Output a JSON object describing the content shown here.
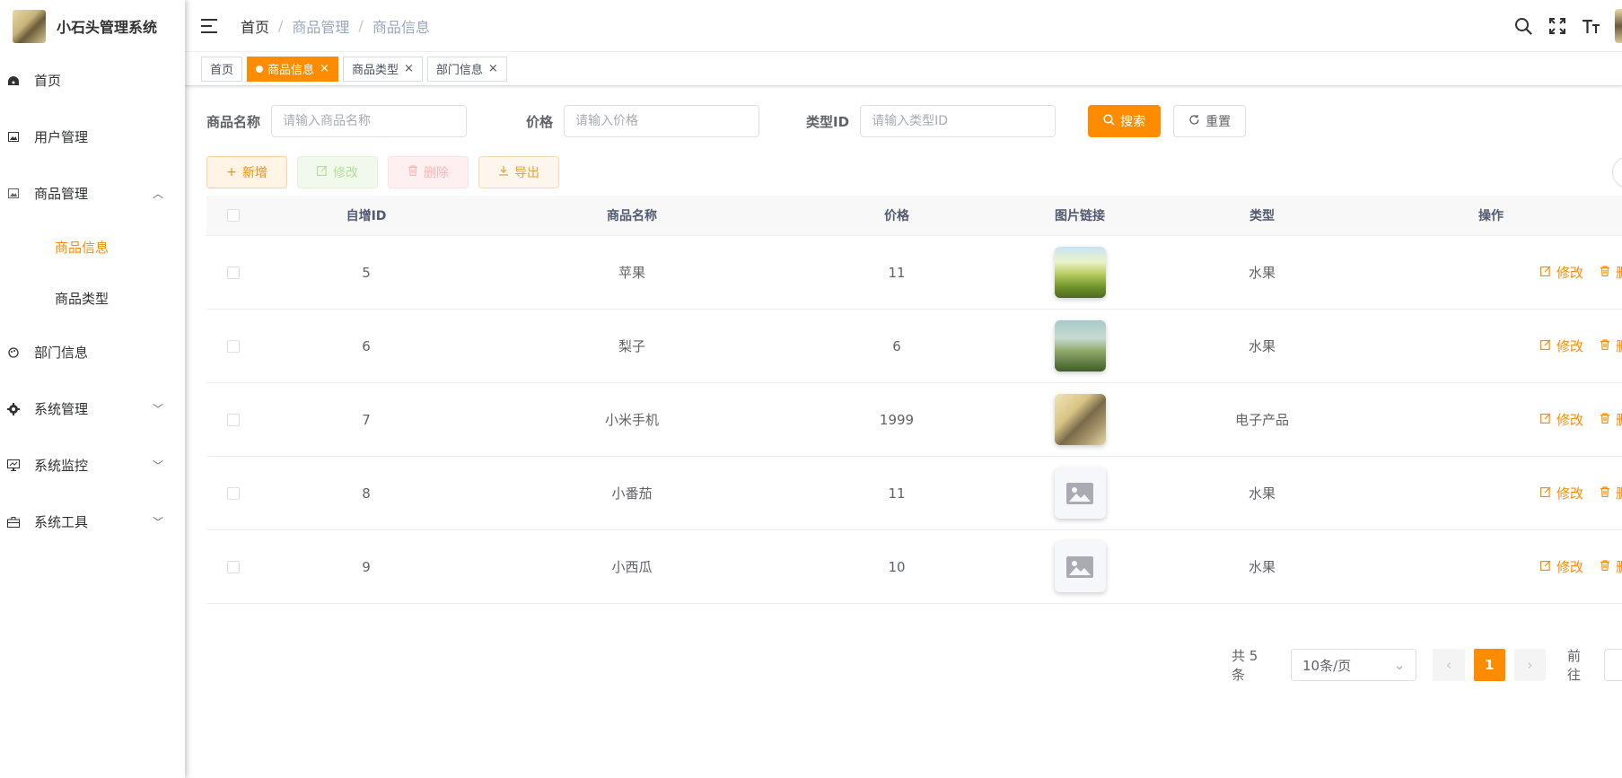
{
  "app": {
    "title": "小石头管理系统"
  },
  "sidebar": {
    "items": [
      {
        "label": "首页"
      },
      {
        "label": "用户管理"
      },
      {
        "label": "商品管理",
        "arrow": "︿"
      },
      {
        "label": "商品信息"
      },
      {
        "label": "商品类型"
      },
      {
        "label": "部门信息"
      },
      {
        "label": "系统管理",
        "arrow": "﹀"
      },
      {
        "label": "系统监控",
        "arrow": "﹀"
      },
      {
        "label": "系统工具",
        "arrow": "﹀"
      }
    ]
  },
  "breadcrumb": [
    "首页",
    "商品管理",
    "商品信息"
  ],
  "tags": [
    {
      "label": "首页"
    },
    {
      "label": "商品信息",
      "close": "×"
    },
    {
      "label": "商品类型",
      "close": "×"
    },
    {
      "label": "部门信息",
      "close": "×"
    }
  ],
  "search": {
    "name_label": "商品名称",
    "name_placeholder": "请输入商品名称",
    "price_label": "价格",
    "price_placeholder": "请输入价格",
    "type_label": "类型ID",
    "type_placeholder": "请输入类型ID",
    "search_btn": "搜索",
    "reset_btn": "重置"
  },
  "toolbar": {
    "add": "新增",
    "edit": "修改",
    "delete": "删除",
    "export": "导出"
  },
  "table": {
    "headers": [
      "自增ID",
      "商品名称",
      "价格",
      "图片链接",
      "类型",
      "操作"
    ],
    "rows": [
      {
        "id": "5",
        "name": "苹果",
        "price": "11",
        "type": "水果"
      },
      {
        "id": "6",
        "name": "梨子",
        "price": "6",
        "type": "水果"
      },
      {
        "id": "7",
        "name": "小米手机",
        "price": "1999",
        "type": "电子产品"
      },
      {
        "id": "8",
        "name": "小番茄",
        "price": "11",
        "type": "水果"
      },
      {
        "id": "9",
        "name": "小西瓜",
        "price": "10",
        "type": "水果"
      }
    ],
    "op_edit": "修改",
    "op_delete": "删除"
  },
  "pagination": {
    "total": "共 5 条",
    "size": "10条/页",
    "current": "1",
    "jump": "前往",
    "prev": "‹",
    "next": "›",
    "size_arrow": "⌄"
  },
  "colors": {
    "accent": "#ff8c00"
  }
}
